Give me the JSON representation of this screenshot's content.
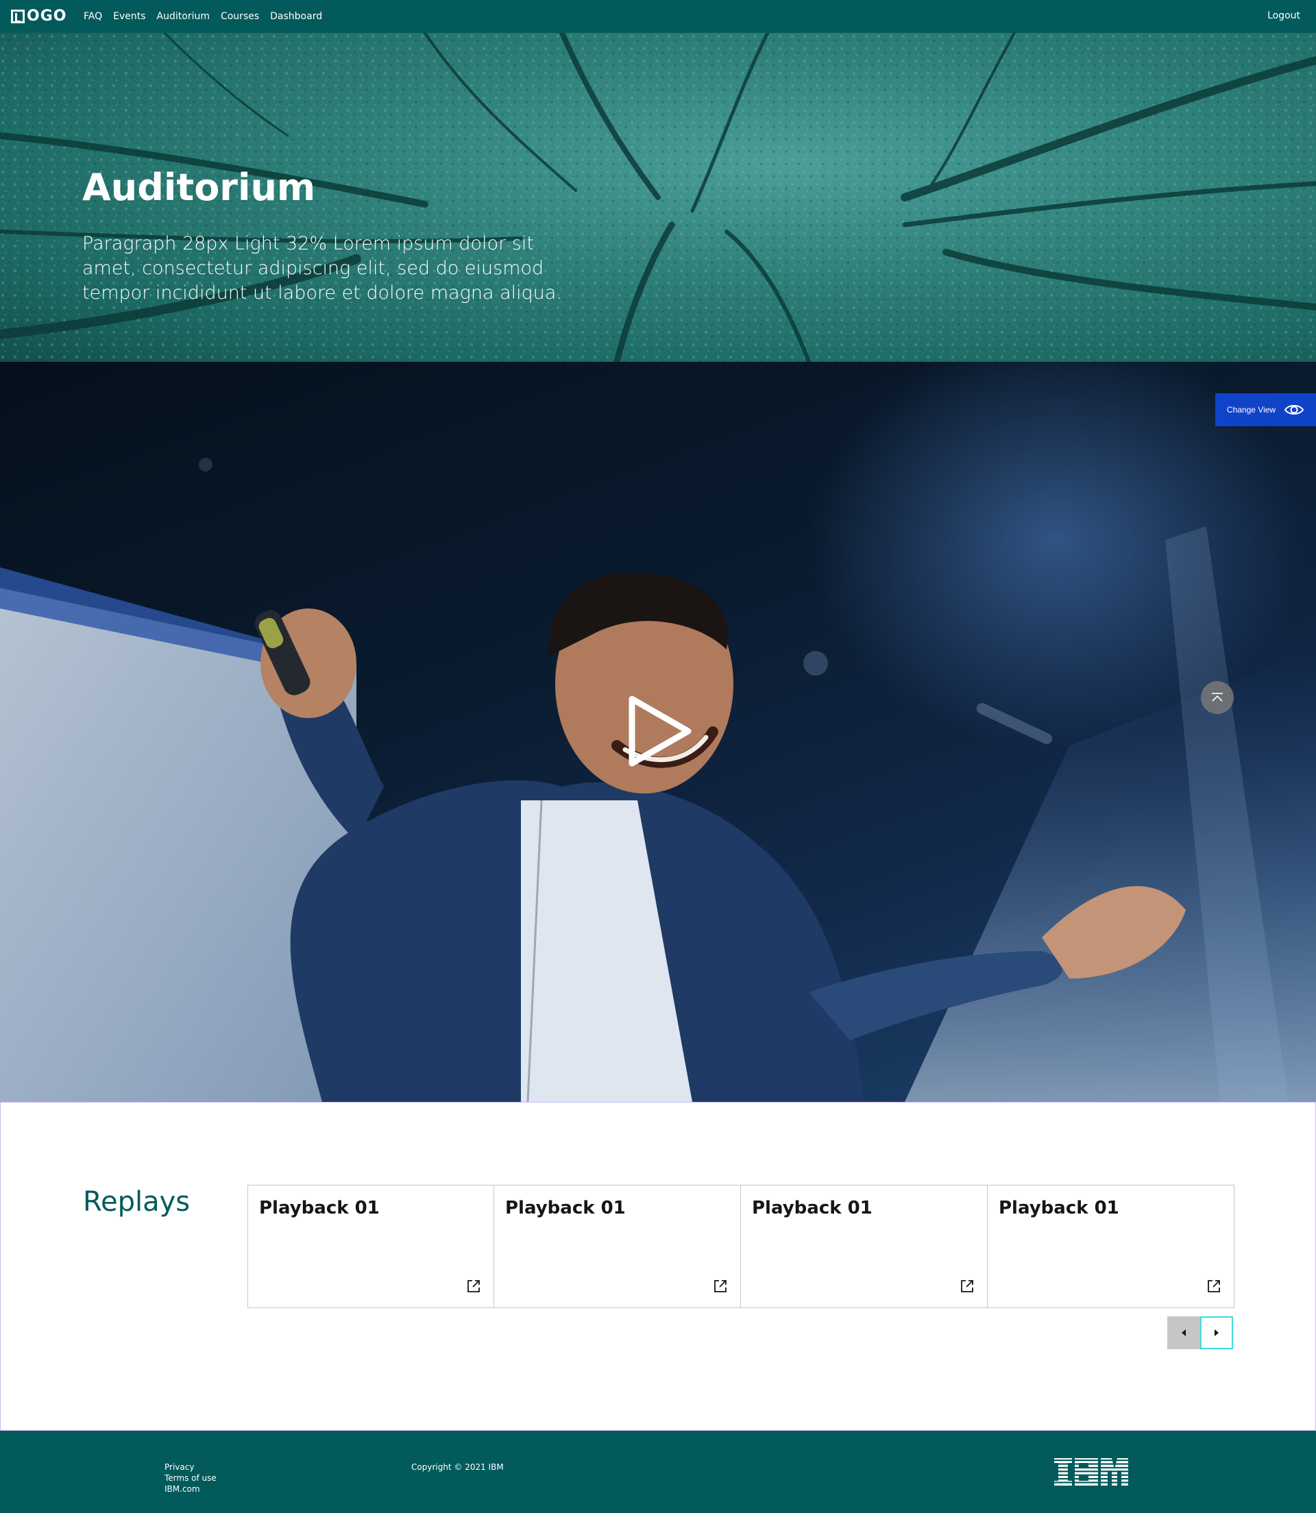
{
  "nav": {
    "logo_text": "OGO",
    "links": [
      "FAQ",
      "Events",
      "Auditorium",
      "Courses",
      "Dashboard"
    ],
    "logout": "Logout"
  },
  "hero": {
    "title": "Auditorium",
    "paragraph": "Paragraph 28px Light 32% Lorem ipsum dolor sit amet, consectetur adipiscing elit, sed do eiusmod tempor incididunt ut labore et dolore magna aliqua."
  },
  "video": {
    "change_view_label": "Change View",
    "icons": {
      "change_view": "eye-icon",
      "play": "play-icon",
      "scroll_top": "scroll-to-top-icon"
    }
  },
  "replays": {
    "title": "Replays",
    "cards": [
      {
        "title": "Playback 01",
        "icon": "external-link-icon"
      },
      {
        "title": "Playback 01",
        "icon": "external-link-icon"
      },
      {
        "title": "Playback 01",
        "icon": "external-link-icon"
      },
      {
        "title": "Playback 01",
        "icon": "external-link-icon"
      }
    ],
    "pager": {
      "prev_icon": "caret-left-icon",
      "next_icon": "caret-right-icon"
    }
  },
  "footer": {
    "links": [
      "Privacy",
      "Terms of use",
      "IBM.com"
    ],
    "copyright": "Copyright © 2021 IBM",
    "brand_logo": "IBM"
  },
  "colors": {
    "brand_teal": "#035a5b",
    "accent_blue": "#0f43c8",
    "pager_focus": "#3ddbd9",
    "replays_title": "#035a5b"
  }
}
